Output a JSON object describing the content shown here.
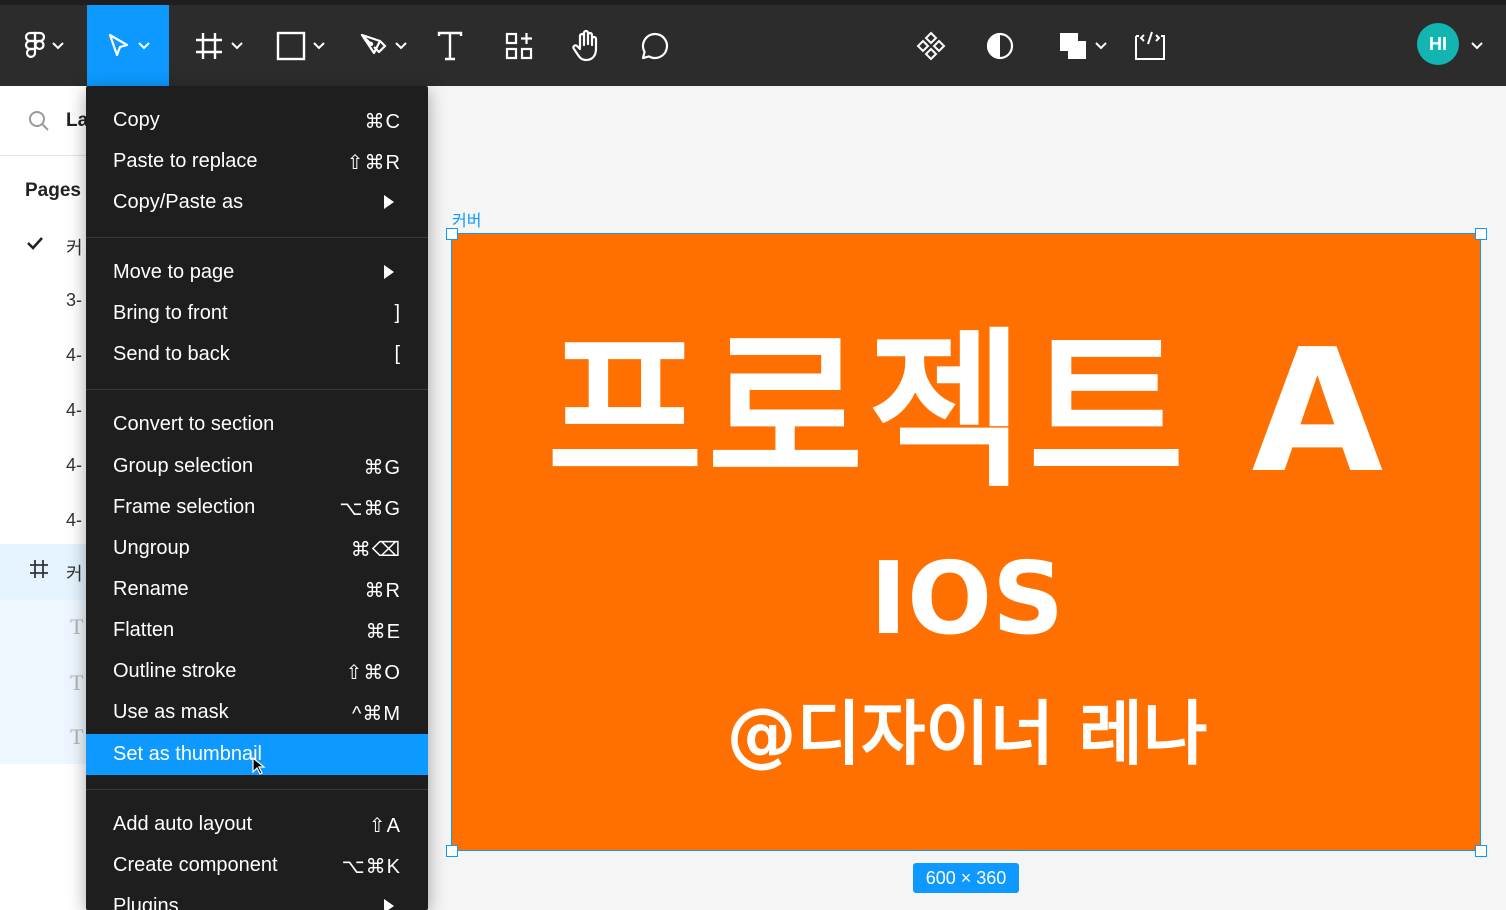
{
  "toolbar": {
    "tools": [
      "figma-menu",
      "move",
      "frame",
      "shape-rectangle",
      "pen",
      "text",
      "resources",
      "hand",
      "comment"
    ],
    "right_tools": [
      "component",
      "contrast",
      "boolean-ops",
      "dev-mode"
    ],
    "avatar_initials": "HI"
  },
  "left_panel": {
    "search_text": "La",
    "pages_header": "Pages",
    "rows": [
      {
        "text": "커",
        "checked": true
      },
      {
        "text": "3-"
      },
      {
        "text": "4-"
      },
      {
        "text": "4-"
      },
      {
        "text": "4-"
      },
      {
        "text": "4-"
      }
    ],
    "layer_frame": "커",
    "text_layer_icon": "T"
  },
  "menu": {
    "items": [
      {
        "label": "Copy",
        "shortcut": "⌘C"
      },
      {
        "label": "Paste to replace",
        "shortcut": "⇧⌘R"
      },
      {
        "label": "Copy/Paste as",
        "submenu": true
      },
      {
        "label": "Move to page",
        "submenu": true
      },
      {
        "label": "Bring to front",
        "shortcut": "]"
      },
      {
        "label": "Send to back",
        "shortcut": "["
      },
      {
        "label": "Convert to section",
        "shortcut": ""
      },
      {
        "label": "Group selection",
        "shortcut": "⌘G"
      },
      {
        "label": "Frame selection",
        "shortcut": "⌥⌘G"
      },
      {
        "label": "Ungroup",
        "shortcut": "⌘⌫"
      },
      {
        "label": "Rename",
        "shortcut": "⌘R"
      },
      {
        "label": "Flatten",
        "shortcut": "⌘E"
      },
      {
        "label": "Outline stroke",
        "shortcut": "⇧⌘O"
      },
      {
        "label": "Use as mask",
        "shortcut": "^⌘M"
      },
      {
        "label": "Set as thumbnail",
        "shortcut": "",
        "highlighted": true
      },
      {
        "label": "Add auto layout",
        "shortcut": "⇧A"
      },
      {
        "label": "Create component",
        "shortcut": "⌥⌘K"
      },
      {
        "label": "Plugins",
        "submenu": true
      }
    ]
  },
  "canvas": {
    "frame_label": "커버",
    "frame_title": "프로젝트 A",
    "frame_subtitle": "IOS",
    "frame_handle": "@디자이너 레나",
    "dimensions": "600 × 360",
    "frame_color": "#ff7000",
    "selection_color": "#0d99ff"
  }
}
